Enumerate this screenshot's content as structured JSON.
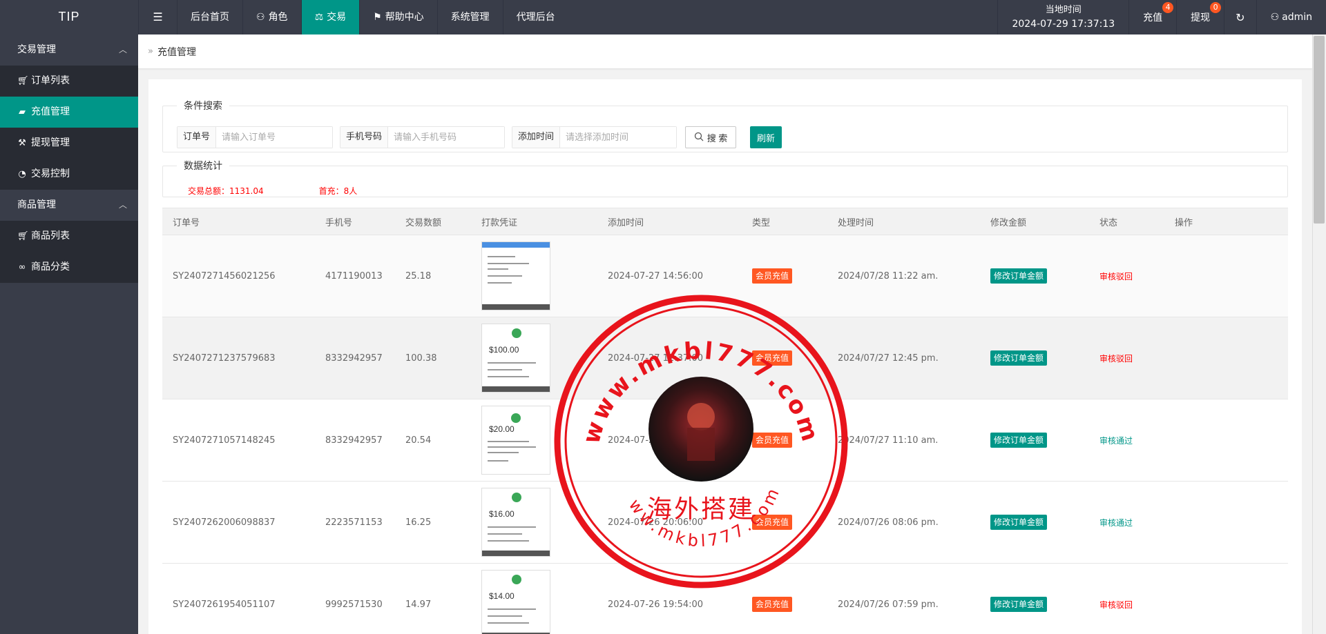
{
  "app": {
    "logo": "TIP"
  },
  "nav": {
    "toggle_icon": "menu-icon",
    "items": [
      {
        "label": "后台首页",
        "icon": ""
      },
      {
        "label": "角色",
        "icon": "user-icon"
      },
      {
        "label": "交易",
        "icon": "scale-icon",
        "active": true
      },
      {
        "label": "帮助中心",
        "icon": "flag-icon"
      },
      {
        "label": "系统管理",
        "icon": ""
      },
      {
        "label": "代理后台",
        "icon": ""
      }
    ]
  },
  "topright": {
    "clock_label": "当地时间",
    "clock_value": "2024-07-29 17:37:13",
    "recharge_label": "充值",
    "recharge_badge": "4",
    "withdraw_label": "提现",
    "withdraw_badge": "0",
    "user": "admin"
  },
  "sidebar": {
    "groups": [
      {
        "label": "交易管理",
        "items": [
          "订单列表",
          "充值管理",
          "提现管理",
          "交易控制"
        ]
      },
      {
        "label": "商品管理",
        "items": [
          "商品列表",
          "商品分类"
        ]
      }
    ]
  },
  "breadcrumb": {
    "current": "充值管理"
  },
  "search": {
    "legend": "条件搜索",
    "order_label": "订单号",
    "order_placeholder": "请输入订单号",
    "phone_label": "手机号码",
    "phone_placeholder": "请输入手机号码",
    "time_label": "添加时间",
    "time_placeholder": "请选择添加时间",
    "search_button": "搜 索",
    "refresh_button": "刷新"
  },
  "stats": {
    "legend": "数据统计",
    "total": "交易总额：1131.04",
    "first": "首充：8人"
  },
  "table": {
    "headers": [
      "订单号",
      "手机号",
      "交易数额",
      "打款凭证",
      "添加时间",
      "类型",
      "处理时间",
      "修改金额",
      "状态",
      "操作"
    ],
    "rows": [
      {
        "order": "SY2407271456021256",
        "phone": "4171190013",
        "amount": "25.18",
        "added": "2024-07-27 14:56:00",
        "type": "会员充值",
        "processed": "2024/07/28 11:22 am.",
        "edit": "修改订单金额",
        "status": "审核驳回",
        "status_kind": "rejected"
      },
      {
        "order": "SY2407271237579683",
        "phone": "8332942957",
        "amount": "100.38",
        "added": "2024-07-27 12:37:00",
        "type": "会员充值",
        "processed": "2024/07/27 12:45 pm.",
        "edit": "修改订单金额",
        "status": "审核驳回",
        "status_kind": "rejected"
      },
      {
        "order": "SY2407271057148245",
        "phone": "8332942957",
        "amount": "20.54",
        "added": "2024-07-27 10:57:00",
        "type": "会员充值",
        "processed": "2024/07/27 11:10 am.",
        "edit": "修改订单金额",
        "status": "审核通过",
        "status_kind": "approved"
      },
      {
        "order": "SY2407262006098837",
        "phone": "2223571153",
        "amount": "16.25",
        "added": "2024-07-26 20:06:00",
        "type": "会员充值",
        "processed": "2024/07/26 08:06 pm.",
        "edit": "修改订单金额",
        "status": "审核通过",
        "status_kind": "approved"
      },
      {
        "order": "SY2407261954051107",
        "phone": "9992571530",
        "amount": "14.97",
        "added": "2024-07-26 19:54:00",
        "type": "会员充值",
        "processed": "2024/07/26 07:59 pm.",
        "edit": "修改订单金额",
        "status": "审核驳回",
        "status_kind": "rejected"
      }
    ]
  },
  "watermark": {
    "url_top": "www.mkbl777.com",
    "url_bottom": "www.mkbl777.com",
    "center_text": "海外搭建"
  },
  "colors": {
    "primary": "#009688",
    "dark": "#393d49",
    "danger": "#ff5722",
    "reject": "#ff0000",
    "stamp": "#e8141c"
  }
}
